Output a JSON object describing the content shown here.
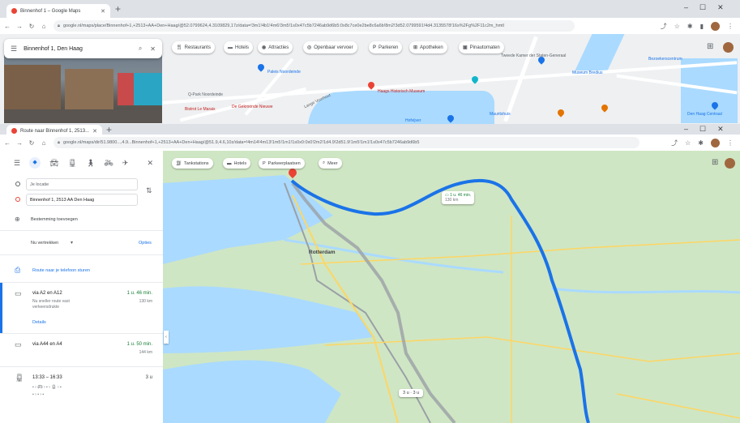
{
  "window1": {
    "tab_title": "Binnenhof 1 – Google Maps",
    "url": "google.nl/maps/place/Binnenhof+1,+2513+AA+Den+Haag/@52.0799624,4.3109829,17z/data=!3m1!4b1!4m6!3m5!1s0x47c5b7246ab9d6b5:0x8c7ce0e2be8c6a6b!8m2!3d52.0799591!4d4.3135578!16s%2Fg%2F11c2m_hmtl",
    "search_value": "Binnenhof 1, Den Haag",
    "chips": [
      "Restaurants",
      "Hotels",
      "Attracties",
      "Openbaar vervoer",
      "Parkeren",
      "Apotheken",
      "Pinautomaten"
    ],
    "map_labels": [
      "Haags Historisch Museum",
      "Q-Park Noordeinde",
      "De Gekroonde Nieuwe",
      "Bistrot Le Marais",
      "Tweede Kamer der Staten-Generaal",
      "Museum Bredius",
      "Bezoekerscentrum",
      "Paleis Noordeinde",
      "Lange Voorhout",
      "Mauritshuis",
      "Hofvijver",
      "Den Haag Centraal"
    ]
  },
  "window2": {
    "tab_title": "Route naar Binnenhof 1, 2513...",
    "url": "google.nl/maps/dir/51.9800...,4.9...Binnenhof+1,+2513+AA+Den+Haag/@51.9,4.6,10z/data=!4m14!4m13!1m5!1m1!1s0x0:0x0!2m2!1d4.9!2d51.9!1m5!1m1!1s0x47c5b7246ab9d6b5",
    "origin_value": "Je locatie",
    "destination_value": "Binnenhof 1, 2513 AA Den Haag",
    "add_destination": "Bestemming toevoegen",
    "depart": "Nu vertrekken",
    "options": "Opties",
    "send_to_phone": "Route naar je telefoon sturen",
    "routes": [
      {
        "title": "via A2 en A12",
        "duration": "1 u. 46 min.",
        "distance": "130 km",
        "note": "Nu sneller route vast",
        "note2": "verkeersdrukte",
        "details": "Details"
      },
      {
        "title": "via A44 en A4",
        "duration": "1 u. 50 min.",
        "distance": "144 km"
      }
    ],
    "transit": {
      "times": "13:33 – 16:33",
      "duration": "3 u"
    },
    "map_chips": [
      "Tankstations",
      "Hotels",
      "Parkeerplaatsen",
      "Meer"
    ],
    "route_box_time": "1 u. 46 min.",
    "route_box_dist": "130 km",
    "city_label": "Rotterdam",
    "transit_box": "3 u  ·  3 u"
  }
}
